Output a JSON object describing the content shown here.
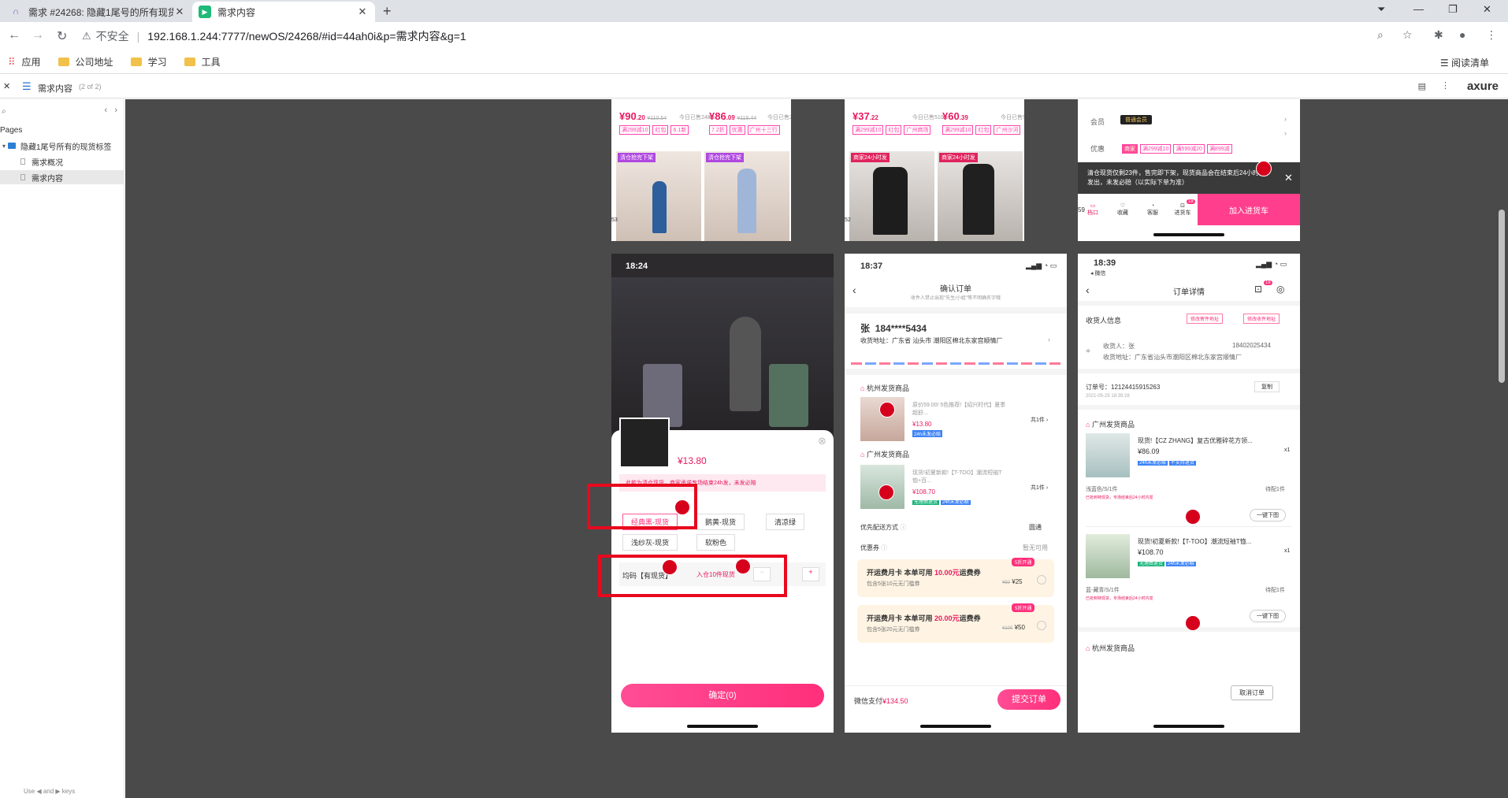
{
  "browser": {
    "tabs": [
      {
        "title": "需求 #24268: 隐藏1尾号的所有现货标签",
        "active": false
      },
      {
        "title": "需求内容",
        "active": true
      }
    ],
    "address": {
      "insecure_label": "不安全",
      "url": "192.168.1.244:7777/newOS/24268/#id=44ah0i&p=需求内容&g=1"
    },
    "bookmarks": [
      "应用",
      "公司地址",
      "学习",
      "工具"
    ],
    "reading_list": "阅读清单"
  },
  "axure": {
    "page_title": "需求内容",
    "page_count": "(2 of 2)",
    "logo": "axure",
    "pages_heading": "Pages",
    "tree": [
      {
        "label": "隐藏1尾号所有的现货标签",
        "level": 0
      },
      {
        "label": "需求概况",
        "level": 1
      },
      {
        "label": "需求内容",
        "level": 1
      }
    ],
    "hint": "Use ◀ and ▶ keys"
  },
  "screens": {
    "p1": {
      "left": {
        "price": "¥90",
        "price_dec": ".20",
        "old": "¥110.54",
        "sold": "今日已售248",
        "tags": [
          "满299减10",
          "红包",
          "6.1新"
        ],
        "badge": "清仓抢完下架",
        "num": "53"
      },
      "right": {
        "price": "¥86",
        "price_dec": ".09",
        "old": "¥115.44",
        "sold": "今日已售248",
        "tags": [
          "7.2折",
          "优惠",
          "广州十三行"
        ],
        "badge": "清仓抢完下架"
      }
    },
    "p2": {
      "left": {
        "price": "¥37",
        "price_dec": ".22",
        "sold": "今日已售510",
        "tags": [
          "满299减10",
          "红包",
          "广州商场"
        ],
        "badge": "商家24小时发",
        "num": "52"
      },
      "right": {
        "price": "¥60",
        "price_dec": ".39",
        "sold": "今日已售504",
        "tags": [
          "满299减10",
          "红包",
          "广州沙河"
        ],
        "badge": "商家24小时发"
      }
    },
    "p3": {
      "member_label": "会员",
      "member_badge": "普通会员",
      "discount_label": "优惠",
      "discount_tags": [
        "商家",
        "满299减10",
        "满599减20",
        "满899减"
      ],
      "notice": "清仓现货仅剩23件，售完即下架，现货商品会在结束后24小时内发出，未发必赔（以实际下单为准）",
      "icons": [
        "档口",
        "收藏",
        "客服",
        "进货车"
      ],
      "cart_badge": "18",
      "num": "59",
      "add_cart": "加入进货车"
    },
    "p4": {
      "time": "18:24",
      "price": "¥13.80",
      "notice": "此款为清仓现货，商家承诺专场结束24h发，未发必赔",
      "colors": [
        "经典黑-现货",
        "鹅黄-现货",
        "清凉绿",
        "浅纱灰-现货",
        "软粉色"
      ],
      "size_label": "均码【有现货】",
      "stock_note": "入仓10件现货",
      "confirm": "确定(0)"
    },
    "p5": {
      "time": "18:37",
      "title": "确认订单",
      "subtitle": "收件人禁止出现\"先生/小姐\"等不明确名字哦",
      "name": "张",
      "phone": "184****5434",
      "address": "收货地址：广东省 汕头市 潮阳区棉北东家宫顺情厂",
      "group1": "杭州发货商品",
      "item1_title": "原价59.00! 5色推荐!【绍兴时代】夏季超舒...",
      "item1_price": "¥13.80",
      "item1_tag": "24h未发必赔",
      "count": "共1件",
      "group2": "广州发货商品",
      "item2_title": "现货!初夏新款!【T-TOO】潮流短袖T恤+百...",
      "item2_price": "¥108.70",
      "item2_tags": [
        "无理由退货",
        "24h未发必赔"
      ],
      "ship_label": "优先配送方式",
      "ship_value": "圆通",
      "coupon_label": "优惠券",
      "coupon_value": "暂无可用",
      "card1_title": "开运费月卡 本单可用",
      "card1_amount": "10.00元",
      "card1_suffix": "运费券",
      "card1_sub": "包含5张10元无门槛券",
      "card1_badge": "5折开通",
      "card1_old": "¥50",
      "card1_price": "¥25",
      "card2_title": "开运费月卡 本单可用",
      "card2_amount": "20.00元",
      "card2_suffix": "运费券",
      "card2_sub": "包含5张20元无门槛券",
      "card2_badge": "5折开通",
      "card2_old": "¥100",
      "card2_price": "¥50",
      "pay_label": "微信支付",
      "pay_amount": "¥134.50",
      "submit": "提交订单"
    },
    "p6": {
      "time": "18:39",
      "wechat": "◂ 微信",
      "title": "订单详情",
      "cart_badge": "18",
      "recv_title": "收货人信息",
      "btn_modify_send": "修改寄件地址",
      "btn_modify_recv": "修改收件地址",
      "recv_name": "收货人：张",
      "recv_phone": "18402025434",
      "recv_addr": "收货地址：广东省汕头市潮阳区棉北东家宫顺情厂",
      "order_no": "订单号：12124415915263",
      "order_time": "2021-05-25 18:39:28",
      "copy": "复制",
      "group1": "广州发货商品",
      "item1_title": "现货!【CZ ZHANG】复古优雅碎花方领...",
      "item1_price": "¥86.09",
      "item1_tags": [
        "24h未发必赔",
        "不支持退货"
      ],
      "qty": "x1",
      "item1_spec": "浅蓝色/S/1件",
      "item1_status": "待配1件",
      "item1_warn": "已抢到特现货，专场结束后24小时内发",
      "item2_title": "现货!初夏新款!【T-TOO】潮流短袖T恤...",
      "item2_price": "¥108.70",
      "item2_tags": [
        "无理由退货",
        "24h未发必赔"
      ],
      "item2_spec": "蓝-藏青/S/1件",
      "item2_status": "待配1件",
      "item2_warn": "已抢到特现货，专场结束后24小时内发",
      "one_key": "一键下图",
      "group2": "杭州发货商品",
      "cancel": "取消订单"
    }
  },
  "colors": {
    "accent": "#ff2f7b",
    "annotation": "#e8091e",
    "canvas": "#4a4a4a"
  }
}
